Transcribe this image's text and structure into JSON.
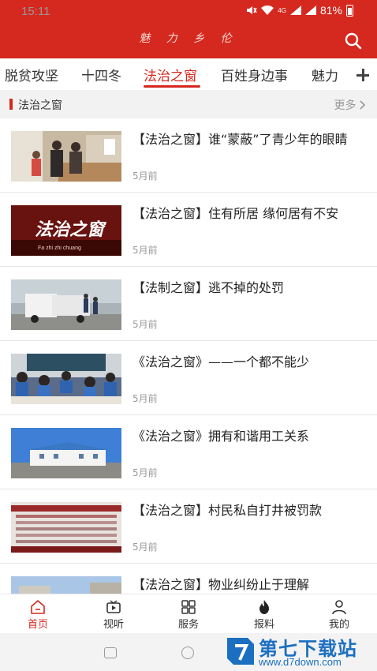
{
  "status_bar": {
    "time": "15:11",
    "network": "4G",
    "battery": "81%"
  },
  "app_bar": {
    "title": "魅 力 乡 伦"
  },
  "tabs": [
    {
      "label": "脱贫攻坚",
      "active": false
    },
    {
      "label": "十四冬",
      "active": false
    },
    {
      "label": "法治之窗",
      "active": true
    },
    {
      "label": "百姓身边事",
      "active": false
    },
    {
      "label": "魅力",
      "active": false
    }
  ],
  "section": {
    "title": "法治之窗",
    "more_label": "更多"
  },
  "articles": [
    {
      "title": "【法治之窗】谁“蒙蔽”了青少年的眼睛",
      "time": "5月前"
    },
    {
      "title": "【法治之窗】住有所居 缘何居有不安",
      "time": "5月前"
    },
    {
      "title": "【法制之窗】逃不掉的处罚",
      "time": "5月前"
    },
    {
      "title": "《法治之窗》——一个都不能少",
      "time": "5月前"
    },
    {
      "title": "《法治之窗》拥有和谐用工关系",
      "time": "5月前"
    },
    {
      "title": "【法治之窗】村民私自打井被罚款",
      "time": "5月前"
    },
    {
      "title": "【法治之窗】物业纠纷止于理解",
      "time": ""
    }
  ],
  "thumb2_text": {
    "main": "法治之窗",
    "sub": "Fa zhi zhi chuang"
  },
  "bottom_nav": [
    {
      "label": "首页",
      "icon": "home-icon",
      "active": true
    },
    {
      "label": "视听",
      "icon": "video-icon",
      "active": false
    },
    {
      "label": "服务",
      "icon": "grid-icon",
      "active": false
    },
    {
      "label": "报料",
      "icon": "flame-icon",
      "active": false
    },
    {
      "label": "我的",
      "icon": "user-icon",
      "active": false
    }
  ],
  "watermark": {
    "text": "第七下载站",
    "url": "www.d7down.com"
  },
  "colors": {
    "brand_red": "#d5281f",
    "watermark_blue": "#1b6fc0"
  }
}
